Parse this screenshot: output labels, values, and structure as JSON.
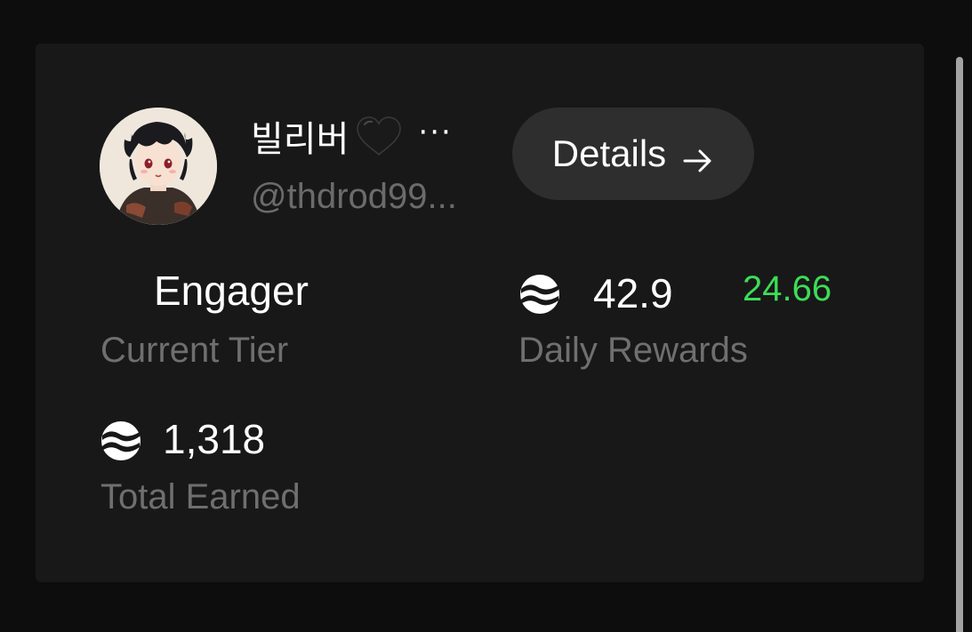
{
  "profile": {
    "display_name": "빌리버",
    "name_truncation": "···",
    "handle": "@thdrod99...",
    "avatar_icon": "anime-avatar",
    "heart_icon": "black-heart-emoji"
  },
  "actions": {
    "details_label": "Details",
    "details_icon": "arrow-right-icon"
  },
  "stats": {
    "tier_value": "Engager",
    "tier_label": "Current Tier",
    "daily_value": "42.9",
    "daily_delta": "24.66",
    "daily_label": "Daily Rewards",
    "total_value": "1,318",
    "total_label": "Total Earned",
    "token_icon": "wave-token-icon"
  },
  "colors": {
    "background": "#0d0d0d",
    "card": "#181818",
    "button": "#2e2e2e",
    "muted_text": "#6f6f6f",
    "delta_green": "#3ddc57"
  }
}
